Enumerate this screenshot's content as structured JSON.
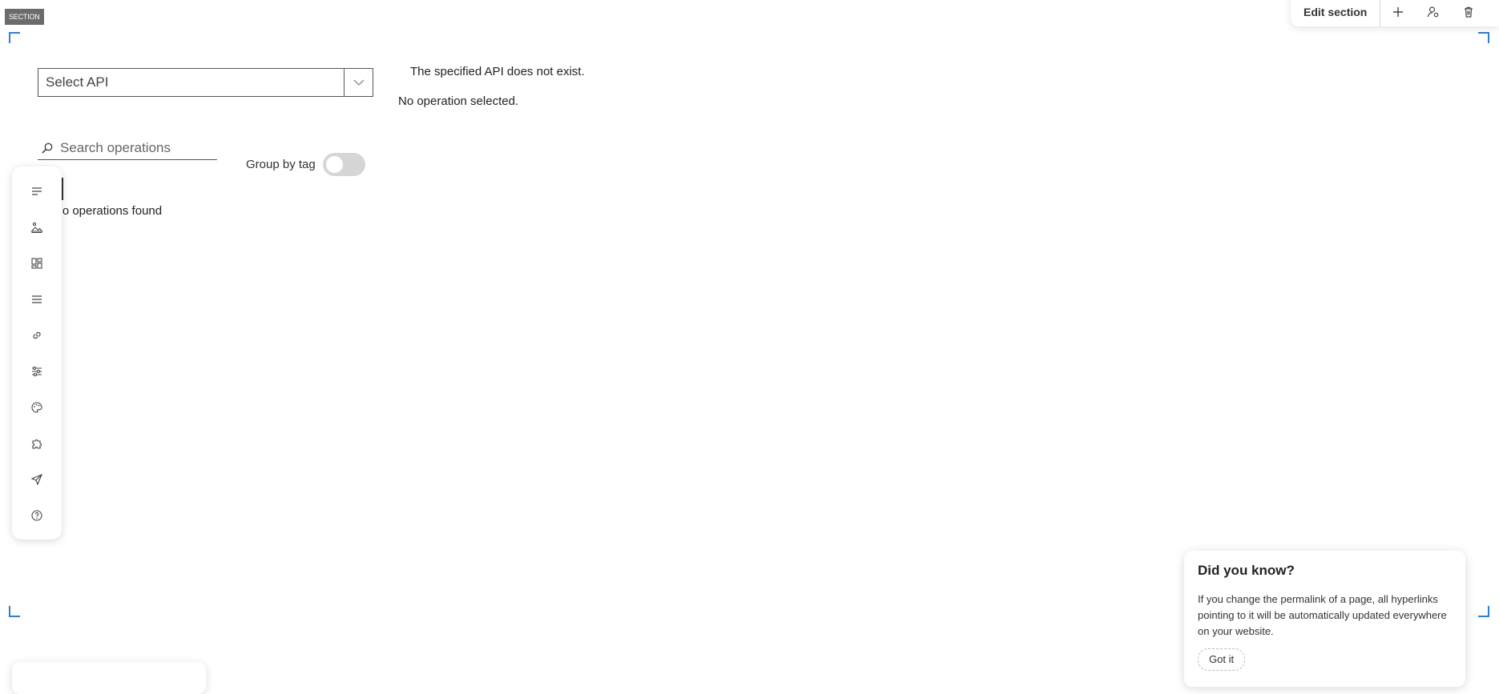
{
  "section_tag": "SECTION",
  "toolbar": {
    "edit_label": "Edit section",
    "icons": [
      "plus-icon",
      "user-settings-icon",
      "trash-icon"
    ]
  },
  "api_select": {
    "value": "Select API"
  },
  "messages": {
    "api_missing": "The specified API does not exist.",
    "no_operation": "No operation selected."
  },
  "search": {
    "placeholder": "Search operations"
  },
  "group_by_tag": {
    "label": "Group by tag",
    "enabled": false
  },
  "operations": {
    "status": "No operations found"
  },
  "sidebar": {
    "items": [
      "text-icon",
      "image-icon",
      "layout-icon",
      "menu-icon",
      "link-icon",
      "settings-sliders-icon",
      "palette-icon",
      "puzzle-icon",
      "send-icon",
      "help-icon"
    ]
  },
  "tip": {
    "title": "Did you know?",
    "body": "If you change the permalink of a page, all hyperlinks pointing to it will be automatically updated everywhere on your website.",
    "button": "Got it"
  }
}
